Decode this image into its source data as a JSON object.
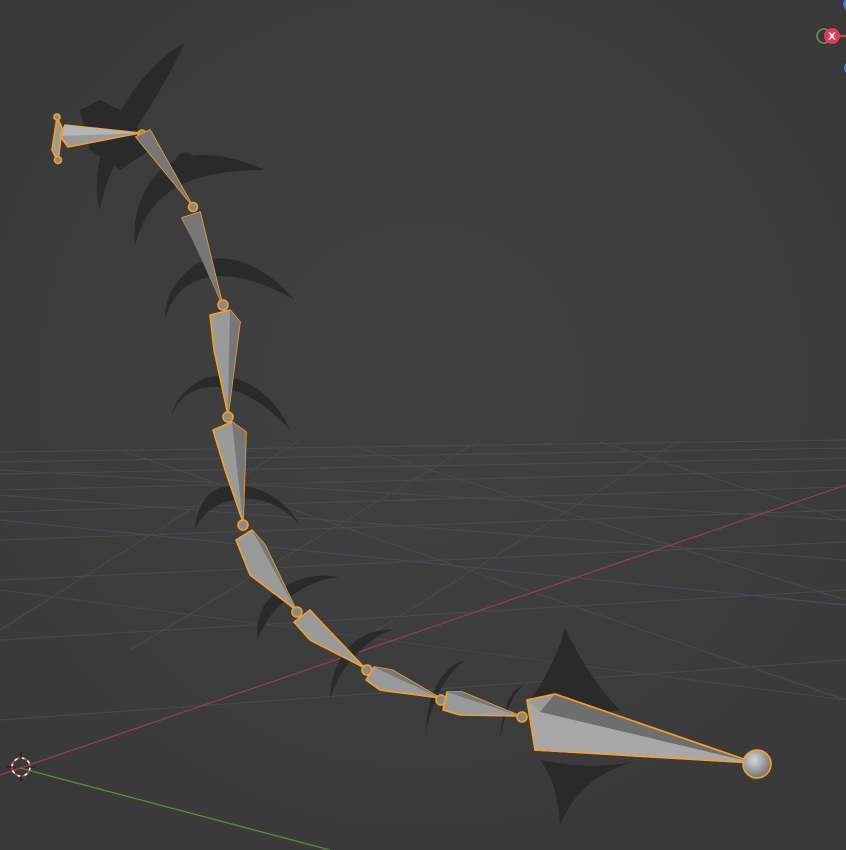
{
  "viewport": {
    "background": "#3d3d3d",
    "grid_color": "#4a4a4a",
    "x_axis_color": "#b5405a",
    "y_axis_color": "#6a9a3a",
    "selection_color": "#f5a023",
    "bone_fill": "#9a9a9a",
    "bone_shadow": "#6c6c6c"
  },
  "gizmo": {
    "x_label": "X",
    "x_color": "#e23a55",
    "y_color": "#6a9a3a",
    "z_color": "#2f7fd0"
  },
  "armature": {
    "bone_count": 12,
    "selected": true
  }
}
